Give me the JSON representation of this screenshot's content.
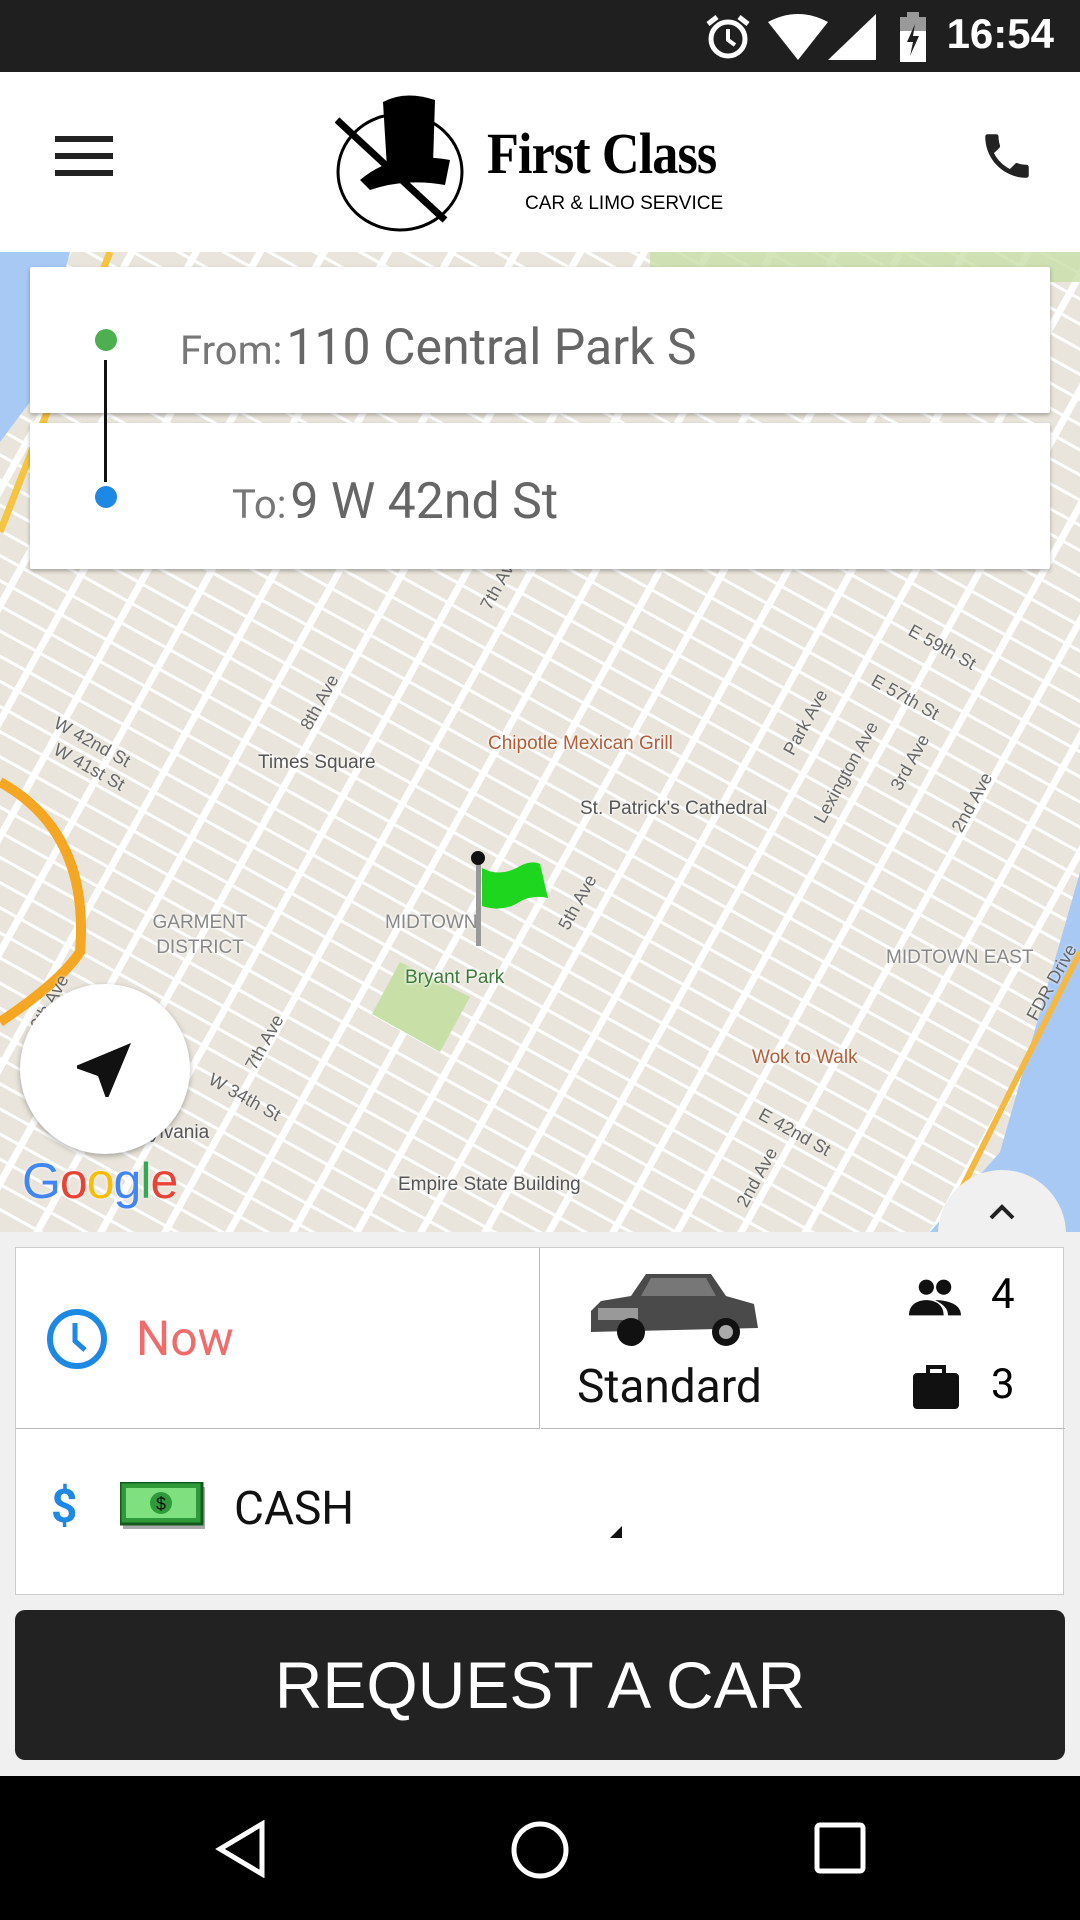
{
  "status_bar": {
    "time": "16:54",
    "icons": [
      "alarm-icon",
      "wifi-icon",
      "signal-icon",
      "battery-charging-icon"
    ]
  },
  "header": {
    "logo_title": "First Class",
    "logo_subtitle": "CAR & LIMO SERVICE",
    "menu_icon": "hamburger-icon",
    "call_icon": "phone-icon"
  },
  "route": {
    "from_label": "From:",
    "from_value": "110 Central Park S",
    "to_label": "To:",
    "to_value": "9 W 42nd St",
    "from_color": "#4caf50",
    "to_color": "#1e88e5"
  },
  "map": {
    "places": [
      "Times Square",
      "Chipotle Mexican Grill",
      "St. Patrick's Cathedral",
      "MIDTOWN",
      "Bryant Park",
      "GARMENT DISTRICT",
      "MIDTOWN EAST",
      "Wok to Walk",
      "Empire State Building",
      "ylvania"
    ],
    "streets": [
      "W 42nd St",
      "W 41st St",
      "8th Ave",
      "7th Ave",
      "5th Ave",
      "Park Ave",
      "Lexington Ave",
      "3rd Ave",
      "2nd Ave",
      "E 59th St",
      "E 57th St",
      "W 34th St",
      "7th Ave",
      "E 42nd St",
      "2nd Ave",
      "FDR Drive",
      "9th Ave"
    ],
    "attribution": "Google",
    "marker": "green-flag"
  },
  "trip": {
    "time_value": "Now",
    "vehicle_name": "Standard",
    "passengers": "4",
    "luggage": "3",
    "payment_value": "CASH",
    "time_color": "#f26b6b",
    "icon_color": "#1e88e5"
  },
  "request_button": "REQUEST A CAR"
}
